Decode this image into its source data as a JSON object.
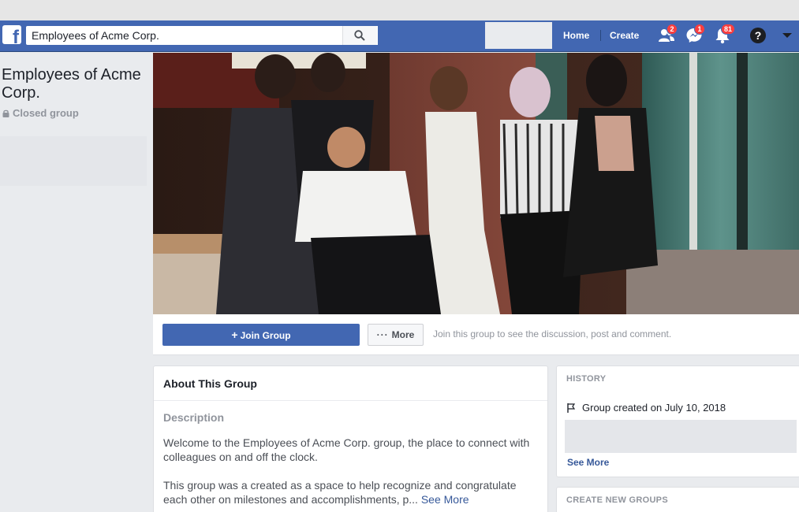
{
  "search": {
    "value": "Employees of Acme Corp."
  },
  "nav": {
    "home": "Home",
    "create": "Create",
    "friend_requests_count": "2",
    "messages_count": "1",
    "notifications_count": "81"
  },
  "group": {
    "name": "Employees of Acme Corp.",
    "privacy": "Closed group"
  },
  "actions": {
    "join": "Join Group",
    "more": "More",
    "hint": "Join this group to see the discussion, post and comment."
  },
  "about": {
    "title": "About This Group",
    "description_label": "Description",
    "paragraph1": "Welcome to the Employees of Acme Corp. group, the place to connect with colleagues on and off the clock.",
    "paragraph2": "This group was a created as a space to help recognize and congratulate each other on milestones and accomplishments, p...",
    "see_more": "See More"
  },
  "history": {
    "header": "HISTORY",
    "created": "Group created on July 10, 2018",
    "see_more": "See More"
  },
  "create_groups": {
    "header": "CREATE NEW GROUPS"
  },
  "colors": {
    "brand": "#4267b2",
    "link": "#365899",
    "badge": "#fa3e3e"
  }
}
